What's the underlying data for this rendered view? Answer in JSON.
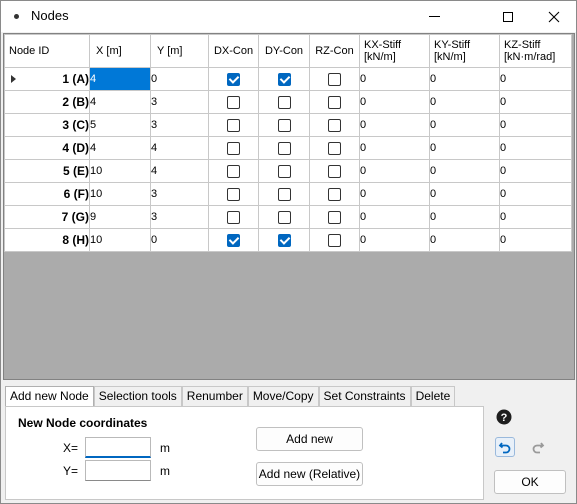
{
  "window": {
    "title": "Nodes",
    "app_icon": "dot-icon",
    "controls": [
      "minimize-icon",
      "maximize-icon",
      "close-icon"
    ]
  },
  "grid": {
    "columns": [
      {
        "label": "Node ID"
      },
      {
        "label": "X [m]"
      },
      {
        "label": "Y [m]"
      },
      {
        "label": "DX-Con"
      },
      {
        "label": "DY-Con"
      },
      {
        "label": "RZ-Con"
      },
      {
        "label": "KX-Stiff",
        "unit": "[kN/m]"
      },
      {
        "label": "KY-Stiff",
        "unit": "[kN/m]"
      },
      {
        "label": "KZ-Stiff",
        "unit": "[kN·m/rad]"
      }
    ],
    "current_row": 0,
    "rows": [
      {
        "id": "1 (A)",
        "x": "4",
        "y": "0",
        "dx": true,
        "dy": true,
        "rz": false,
        "kx": "0",
        "ky": "0",
        "kz": "0"
      },
      {
        "id": "2 (B)",
        "x": "4",
        "y": "3",
        "dx": false,
        "dy": false,
        "rz": false,
        "kx": "0",
        "ky": "0",
        "kz": "0"
      },
      {
        "id": "3 (C)",
        "x": "5",
        "y": "3",
        "dx": false,
        "dy": false,
        "rz": false,
        "kx": "0",
        "ky": "0",
        "kz": "0"
      },
      {
        "id": "4 (D)",
        "x": "4",
        "y": "4",
        "dx": false,
        "dy": false,
        "rz": false,
        "kx": "0",
        "ky": "0",
        "kz": "0"
      },
      {
        "id": "5 (E)",
        "x": "10",
        "y": "4",
        "dx": false,
        "dy": false,
        "rz": false,
        "kx": "0",
        "ky": "0",
        "kz": "0"
      },
      {
        "id": "6 (F)",
        "x": "10",
        "y": "3",
        "dx": false,
        "dy": false,
        "rz": false,
        "kx": "0",
        "ky": "0",
        "kz": "0"
      },
      {
        "id": "7 (G)",
        "x": "9",
        "y": "3",
        "dx": false,
        "dy": false,
        "rz": false,
        "kx": "0",
        "ky": "0",
        "kz": "0"
      },
      {
        "id": "8 (H)",
        "x": "10",
        "y": "0",
        "dx": true,
        "dy": true,
        "rz": false,
        "kx": "0",
        "ky": "0",
        "kz": "0"
      }
    ]
  },
  "tabs": [
    {
      "label": "Add new Node",
      "active": true
    },
    {
      "label": "Selection tools"
    },
    {
      "label": "Renumber"
    },
    {
      "label": "Move/Copy"
    },
    {
      "label": "Set Constraints"
    },
    {
      "label": "Delete"
    }
  ],
  "add_node": {
    "section_title": "New Node coordinates",
    "x_label": "X=",
    "y_label": "Y=",
    "x_value": "",
    "y_value": "",
    "unit": "m",
    "add_button": "Add new",
    "add_relative_button": "Add new (Relative)"
  },
  "side": {
    "help_icon": "help-icon",
    "undo_icon": "undo-icon",
    "redo_icon": "redo-icon",
    "ok_button": "OK"
  },
  "colors": {
    "selection": "#0078d7",
    "checkbox_on": "#0067c0",
    "grid_background": "#ababab"
  }
}
